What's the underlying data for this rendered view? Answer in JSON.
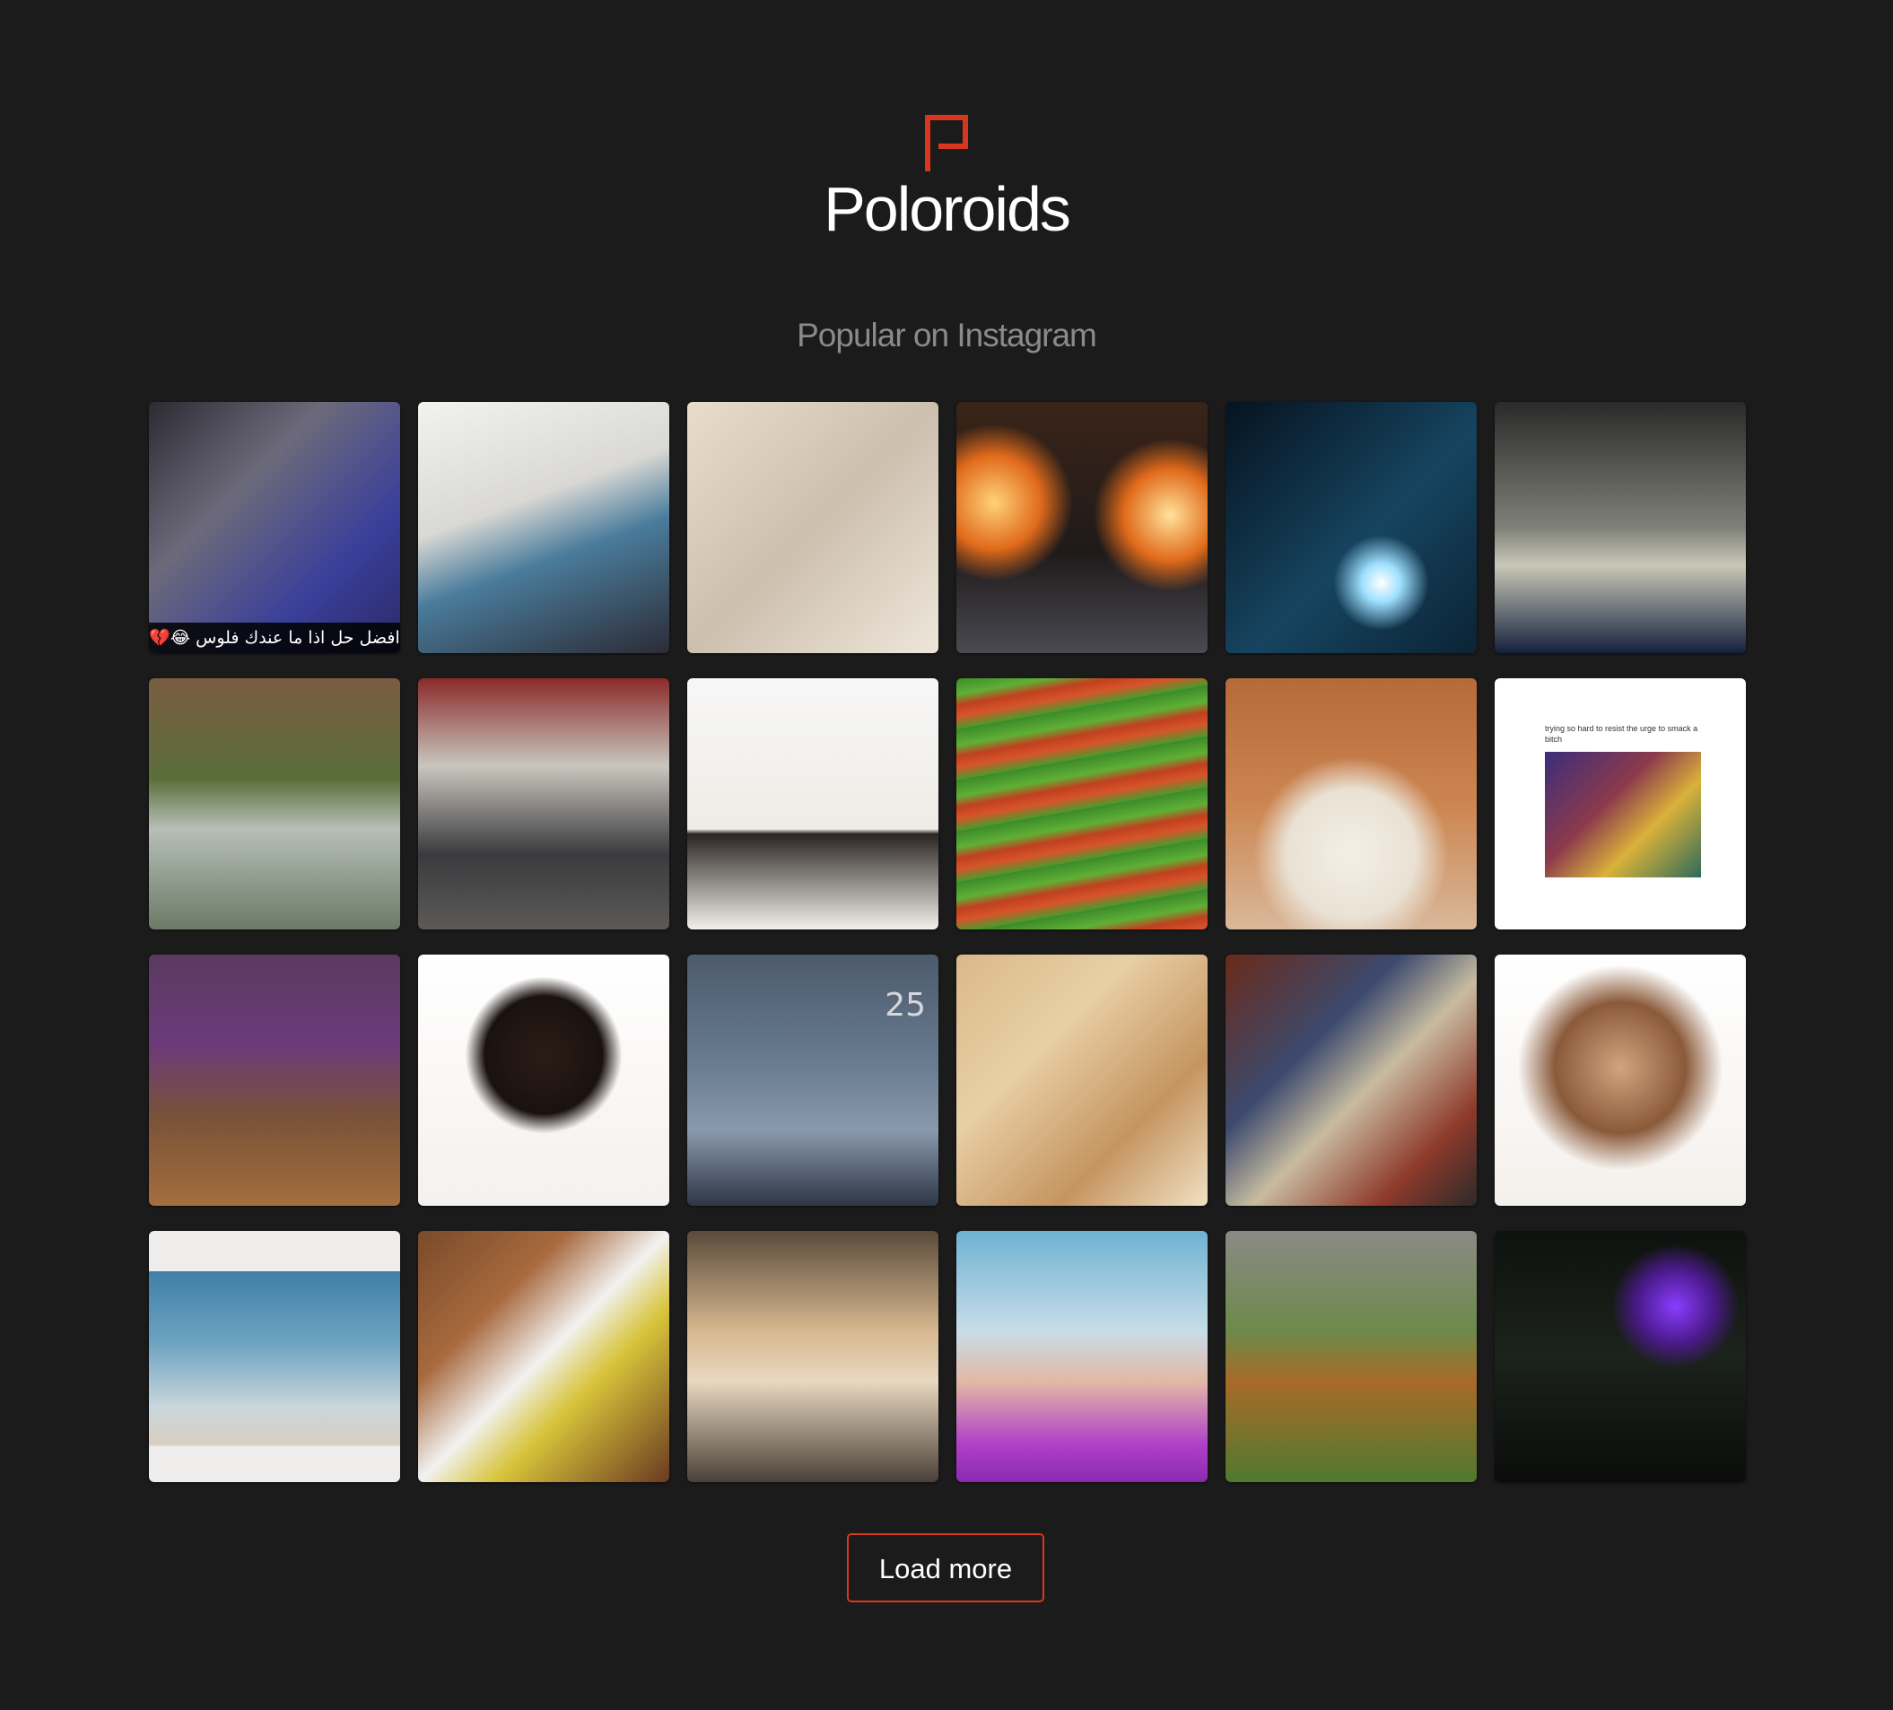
{
  "app": {
    "brand": "Poloroids",
    "logo_icon": "poloroids-logo-icon",
    "accent_color": "#d8361e",
    "background_color": "#1b1b1c"
  },
  "header": {
    "subtitle": "Popular on Instagram"
  },
  "photos": [
    {
      "subject": "hands counting money at machine",
      "caption": "افضل حل اذا ما عندك فلوس 😂💔",
      "bg": "linear-gradient(135deg,#2b2b33 0%,#6c6a7a 35%,#3a3f9a 70%,#2a2a66 100%)"
    },
    {
      "subject": "hospital bed",
      "bg": "linear-gradient(160deg,#f2f2f0 0%,#d9d8d4 40%,#4a7c9c 60%,#2c2c36 100%)"
    },
    {
      "subject": "woman with baby",
      "bg": "linear-gradient(135deg,#e9dccb 0%,#cdbfae 50%,#ede6da 100%)"
    },
    {
      "subject": "stage with flames",
      "bg": "radial-gradient(circle at 15% 40%,#ffd27a 0%,#e06a1b 18%,transparent 30%),radial-gradient(circle at 85% 45%,#ffe39a 0%,#e06a1b 18%,transparent 30%),linear-gradient(180deg,#3a2418 0%,#1f1a1a 60%,#4a4a52 100%)"
    },
    {
      "subject": "night sparkler scene",
      "bg": "radial-gradient(circle at 62% 72%,#ffffff 0%,#9fe0ff 8%,transparent 20%),linear-gradient(135deg,#06131f 0%,#164460 55%,#0b2335 100%)"
    },
    {
      "subject": "feet in shackles",
      "bg": "linear-gradient(180deg,#2a2a2a 0%,#7f8078 50%,#c9c8b8 65%,#14213d 100%)"
    },
    {
      "subject": "drifting car",
      "bg": "linear-gradient(180deg,#7a5c42 0%,#5b6e3a 40%,#b7bfb8 60%,#6b7a66 100%)"
    },
    {
      "subject": "pool table",
      "bg": "linear-gradient(180deg,#8a2a2a 0%,#c9c6be 35%,#3b3b3e 70%,#5c5a58 100%)"
    },
    {
      "subject": "man in white shirt",
      "bg": "linear-gradient(180deg,#f7f7f7 0%,#efece6 60%,#2a2522 62%,#f3f1ec 100%)"
    },
    {
      "subject": "lettuce tacos",
      "bg": "repeating-linear-gradient(170deg,#3c8a2a 0px,#5fb035 18px,#c0401f 30px,#d7542a 42px,#4a9a2c 56px)"
    },
    {
      "subject": "corgi face",
      "bg": "radial-gradient(circle at 50% 70%,#f4efe6 0%,#e9e1d3 30%,transparent 45%),linear-gradient(180deg,#b66a3a 0%,#cc8550 50%,#d9b89a 100%)"
    },
    {
      "subject": "meme with illustration",
      "meme_text": "trying so hard to resist the urge to smack a bitch",
      "bg": "#ffffff"
    },
    {
      "subject": "aerial silks dancers",
      "bg": "linear-gradient(180deg,#5a3a5f 0%,#6b3a7a 35%,#7a5238 65%,#a56e3e 100%)"
    },
    {
      "subject": "woman with afro",
      "bg": "radial-gradient(circle at 50% 40%,#2a1c16 0%,#1a1210 30%,transparent 40%),linear-gradient(180deg,#ffffff 0%,#f4f1ee 100%)"
    },
    {
      "subject": "young man in sweater",
      "overlay": "25",
      "bg": "linear-gradient(180deg,#4c5a6c 0%,#6a7d92 45%,#8a99ad 70%,#2d3646 100%)"
    },
    {
      "subject": "woman with curly hair",
      "bg": "linear-gradient(135deg,#d9b98a 0%,#e8cfa5 35%,#c59560 70%,#f0e0c4 100%)"
    },
    {
      "subject": "woman at graffiti wall",
      "bg": "linear-gradient(135deg,#6a2a1a 0%,#3c4a6e 35%,#c8bba0 55%,#8e3a2a 80%,#2a2a2a 100%)"
    },
    {
      "subject": "woman portrait",
      "bg": "radial-gradient(circle at 50% 45%,#d3a47f 0%,#8a5a3a 35%,transparent 55%),linear-gradient(180deg,#ffffff 0%,#f4f0ec 100%)"
    },
    {
      "subject": "beach",
      "bg": "linear-gradient(180deg,#eeedec 0%,#eeedec 16%,#3f7fa8 16%,#6ea4c2 45%,#c9d6dc 70%,#d8cfc0 85%,#eeedec 86%,#eeedec 100%)"
    },
    {
      "subject": "flat lay outfit",
      "bg": "linear-gradient(135deg,#7a4a2a 0%,#a86a3e 30%,#f2f2f2 50%,#d8c43a 65%,#6a3a20 100%)"
    },
    {
      "subject": "blonde peace sign selfie",
      "bg": "linear-gradient(180deg,#5a4a3a 0%,#d8b890 40%,#e9d8c0 60%,#4a4038 100%)"
    },
    {
      "subject": "woman with blue hair",
      "bg": "linear-gradient(180deg,#6fb2d2 0%,#c7dde8 40%,#e2b8a5 60%,#b040c8 85%,#8a2ab0 100%)"
    },
    {
      "subject": "woman with pasta pan",
      "bg": "linear-gradient(180deg,#8a8a86 0%,#6c8a4a 40%,#a86a2a 60%,#4f7a2e 100%)"
    },
    {
      "subject": "dark alley figures",
      "bg": "radial-gradient(ellipse at 72% 30%,#8a3cff 0%,#4a1a8a 15%,transparent 25%),linear-gradient(180deg,#0e120e 0%,#1c221c 50%,#0a0c0a 100%)"
    }
  ],
  "actions": {
    "load_more_label": "Load more"
  }
}
